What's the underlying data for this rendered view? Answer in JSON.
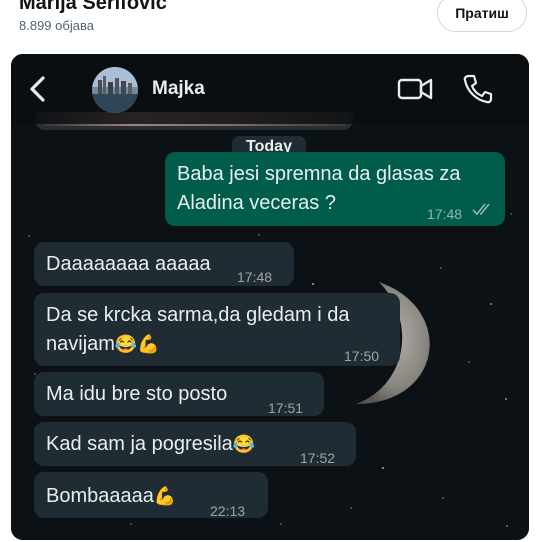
{
  "post": {
    "author": "Marija Serifović",
    "post_count": "8.899 објава",
    "follow_label": "Пратиш"
  },
  "chat": {
    "contact_name": "Majka",
    "date_separator": "Today",
    "messages": [
      {
        "direction": "outgoing",
        "line1": "Baba jesi spremna da glasas za",
        "line2": "Aladina veceras ?",
        "time": "17:48",
        "status": "read"
      },
      {
        "direction": "incoming",
        "text": "Daaaaaaaa aaaaa",
        "time": "17:48"
      },
      {
        "direction": "incoming",
        "line1": "Da se krcka sarma,da gledam i da",
        "line2": "navijam",
        "emoji": "😂💪",
        "time": "17:50"
      },
      {
        "direction": "incoming",
        "text": "Ma idu bre sto posto",
        "time": "17:51"
      },
      {
        "direction": "incoming",
        "text": "Kad sam ja pogresila",
        "emoji": "😂",
        "time": "17:52"
      },
      {
        "direction": "incoming",
        "text": "Bombaaaaa",
        "emoji": "💪",
        "time": "22:13"
      }
    ]
  },
  "icons": {
    "back": "chevron-left-icon",
    "video_call": "video-camera-icon",
    "voice_call": "phone-icon",
    "read_receipt": "double-check-icon"
  },
  "colors": {
    "chat_background": "#0b1115",
    "incoming_bubble": "#202c33",
    "outgoing_bubble": "#005c4b",
    "text": "#e9edef"
  }
}
